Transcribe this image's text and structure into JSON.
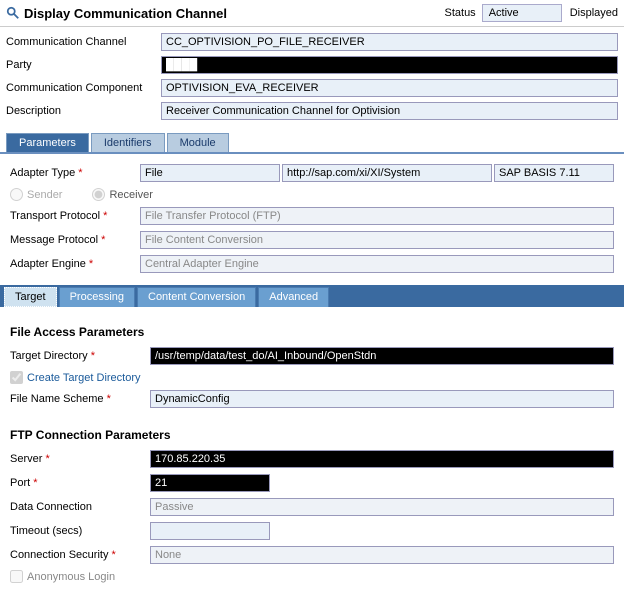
{
  "header": {
    "title": "Display Communication Channel",
    "status_label": "Status",
    "status_value": "Active",
    "displayed": "Displayed"
  },
  "form": {
    "comm_channel_label": "Communication Channel",
    "comm_channel_value": "CC_OPTIVISION_PO_FILE_RECEIVER",
    "party_label": "Party",
    "party_value": "████",
    "comm_component_label": "Communication Component",
    "comm_component_value": "OPTIVISION_EVA_RECEIVER",
    "description_label": "Description",
    "description_value": "Receiver Communication Channel for Optivision"
  },
  "tabs": {
    "parameters": "Parameters",
    "identifiers": "Identifiers",
    "module": "Module"
  },
  "adapter": {
    "type_label": "Adapter Type",
    "type_value": "File",
    "namespace": "http://sap.com/xi/XI/System",
    "version": "SAP BASIS 7.11",
    "sender": "Sender",
    "receiver": "Receiver",
    "transport_label": "Transport Protocol",
    "transport_value": "File Transfer Protocol (FTP)",
    "message_label": "Message Protocol",
    "message_value": "File Content Conversion",
    "engine_label": "Adapter Engine",
    "engine_value": "Central Adapter Engine"
  },
  "subtabs": {
    "target": "Target",
    "processing": "Processing",
    "content": "Content Conversion",
    "advanced": "Advanced"
  },
  "file_access": {
    "section": "File Access Parameters",
    "target_dir_label": "Target Directory",
    "target_dir_value": "/usr/temp/data/test_do/AI_Inbound/OpenStdn",
    "create_dir": "Create Target Directory",
    "scheme_label": "File Name Scheme",
    "scheme_value": "DynamicConfig"
  },
  "ftp": {
    "section": "FTP Connection Parameters",
    "server_label": "Server",
    "server_value": "170.85.220.35",
    "port_label": "Port",
    "port_value": "21",
    "dataconn_label": "Data Connection",
    "dataconn_value": "Passive",
    "timeout_label": "Timeout (secs)",
    "timeout_value": "",
    "security_label": "Connection Security",
    "security_value": "None",
    "anon": "Anonymous Login"
  }
}
